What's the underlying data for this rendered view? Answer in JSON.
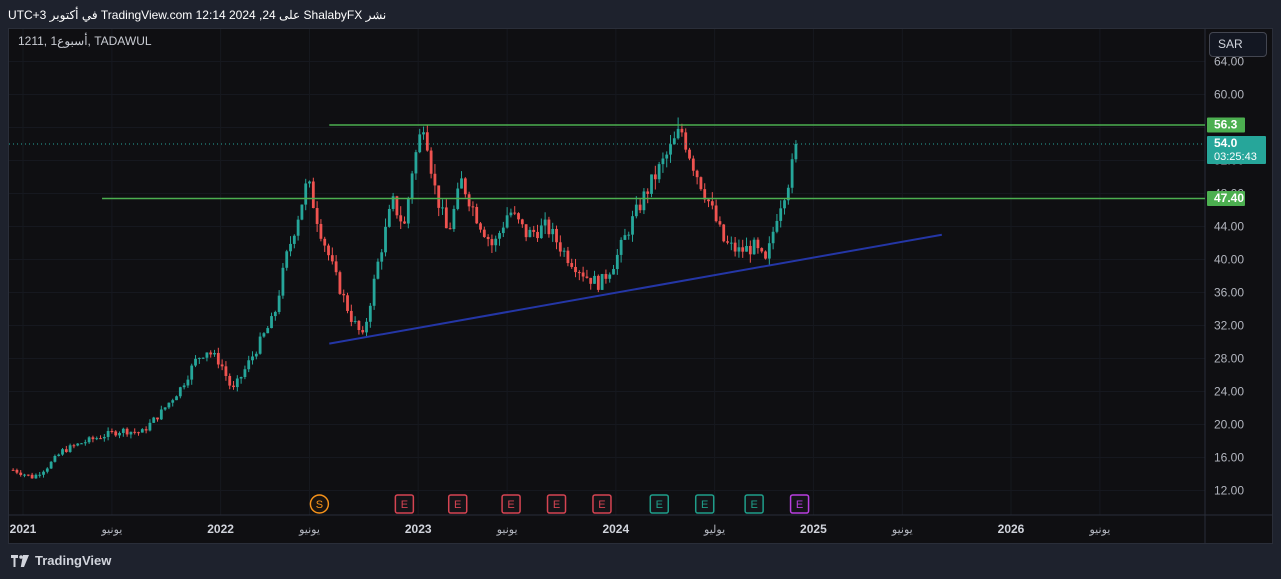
{
  "header": {
    "publish_text": "نشر ShalabyFX على TradingView.com 12:14 2024 ,24 في أكتوبر UTC+3"
  },
  "symbol": {
    "label": "1211, 1أسبوع, TADAWUL"
  },
  "currency": {
    "label": "SAR"
  },
  "footer": {
    "brand": "TradingView"
  },
  "chart_data": {
    "type": "candlestick",
    "y_ticks": [
      "64.00",
      "60.00",
      "56.00",
      "52.00",
      "48.00",
      "44.00",
      "40.00",
      "36.00",
      "32.00",
      "28.00",
      "24.00",
      "20.00",
      "16.00",
      "12.00"
    ],
    "x_ticks": [
      "2021",
      "يونيو",
      "2022",
      "يونيو",
      "2023",
      "يونيو",
      "2024",
      "يوليو",
      "2025",
      "يونيو",
      "2026",
      "يونيو"
    ],
    "ylim": [
      9.5,
      65
    ],
    "price_tags": [
      {
        "label": "56.3",
        "value": 56.3,
        "color": "#4caf50"
      },
      {
        "label": "54.0",
        "sub": "03:25:43",
        "value": 54.0,
        "color": "#26a69a"
      },
      {
        "label": "47.40",
        "value": 47.4,
        "color": "#4caf50"
      }
    ],
    "horizontal_lines": [
      {
        "value": 56.3,
        "color": "#4caf50",
        "from_date": 2022.55
      },
      {
        "value": 47.4,
        "color": "#4caf50",
        "from_date": 2021.4
      }
    ],
    "trend_line": {
      "from": [
        2022.55,
        29.8
      ],
      "to": [
        2025.65,
        43.0
      ],
      "color": "#2436a6"
    },
    "up_color": "#26a69a",
    "down_color": "#ef5350",
    "price_path": [
      [
        2020.95,
        14.5
      ],
      [
        2021.05,
        13.6
      ],
      [
        2021.12,
        14.8
      ],
      [
        2021.2,
        16.8
      ],
      [
        2021.3,
        17.8
      ],
      [
        2021.4,
        18.6
      ],
      [
        2021.5,
        19.3
      ],
      [
        2021.6,
        19.0
      ],
      [
        2021.7,
        21.5
      ],
      [
        2021.8,
        24.5
      ],
      [
        2021.88,
        28.0
      ],
      [
        2021.93,
        29.0
      ],
      [
        2022.0,
        27.5
      ],
      [
        2022.06,
        24.0
      ],
      [
        2022.12,
        26.5
      ],
      [
        2022.2,
        30.0
      ],
      [
        2022.27,
        33.0
      ],
      [
        2022.33,
        40.0
      ],
      [
        2022.4,
        46.0
      ],
      [
        2022.44,
        49.5
      ],
      [
        2022.5,
        44.0
      ],
      [
        2022.58,
        38.0
      ],
      [
        2022.66,
        33.0
      ],
      [
        2022.72,
        30.5
      ],
      [
        2022.8,
        40.0
      ],
      [
        2022.87,
        47.0
      ],
      [
        2022.93,
        44.0
      ],
      [
        2022.97,
        51.0
      ],
      [
        2023.03,
        57.0
      ],
      [
        2023.08,
        49.0
      ],
      [
        2023.15,
        43.0
      ],
      [
        2023.22,
        49.5
      ],
      [
        2023.3,
        45.0
      ],
      [
        2023.38,
        41.5
      ],
      [
        2023.46,
        46.0
      ],
      [
        2023.55,
        43.0
      ],
      [
        2023.65,
        44.0
      ],
      [
        2023.75,
        40.5
      ],
      [
        2023.85,
        38.0
      ],
      [
        2023.92,
        37.0
      ],
      [
        2024.0,
        40.0
      ],
      [
        2024.07,
        44.0
      ],
      [
        2024.15,
        48.0
      ],
      [
        2024.22,
        51.0
      ],
      [
        2024.28,
        53.5
      ],
      [
        2024.33,
        55.8
      ],
      [
        2024.4,
        51.0
      ],
      [
        2024.47,
        47.0
      ],
      [
        2024.55,
        42.0
      ],
      [
        2024.62,
        41.0
      ],
      [
        2024.7,
        41.5
      ],
      [
        2024.76,
        39.5
      ],
      [
        2024.82,
        46.0
      ],
      [
        2024.88,
        50.0
      ],
      [
        2024.92,
        54.0
      ]
    ],
    "event_markers": [
      {
        "letter": "S",
        "date": 2022.5,
        "color": "#f7931a",
        "round": true
      },
      {
        "letter": "E",
        "date": 2022.93,
        "color": "#d64452"
      },
      {
        "letter": "E",
        "date": 2023.2,
        "color": "#d64452"
      },
      {
        "letter": "E",
        "date": 2023.47,
        "color": "#d64452"
      },
      {
        "letter": "E",
        "date": 2023.7,
        "color": "#d64452"
      },
      {
        "letter": "E",
        "date": 2023.93,
        "color": "#d64452"
      },
      {
        "letter": "E",
        "date": 2024.22,
        "color": "#1f9e8a"
      },
      {
        "letter": "E",
        "date": 2024.45,
        "color": "#1f9e8a"
      },
      {
        "letter": "E",
        "date": 2024.7,
        "color": "#1f9e8a"
      },
      {
        "letter": "E",
        "date": 2024.93,
        "color": "#b93fe0"
      }
    ]
  }
}
